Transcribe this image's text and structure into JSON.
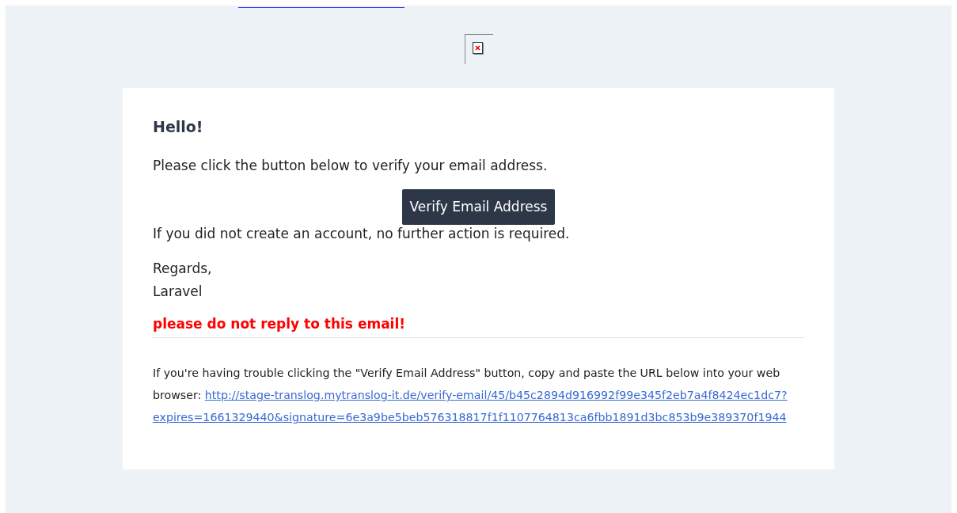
{
  "email": {
    "greeting": "Hello!",
    "intro": "Please click the button below to verify your email address.",
    "button": "Verify Email Address",
    "outro": "If you did not create an account, no further action is required.",
    "salutation": "Regards,",
    "signature": "Laravel",
    "warning": "please do not reply to this email!",
    "subcopy": {
      "text": "If you're having trouble clicking the \"Verify Email Address\" button, copy and paste the URL below into your web browser:",
      "url_lines": [
        "http://stage-translog.mytranslog-it.de/verify-email/45/b45c2894d916992f99e345f2eb7a4f8424ec1dc7?",
        "expires=1661329440&signature=6e3a9be5beb576318817f1f1107764813ca6fbb1891d3bc853b9e389370f1944"
      ]
    }
  }
}
